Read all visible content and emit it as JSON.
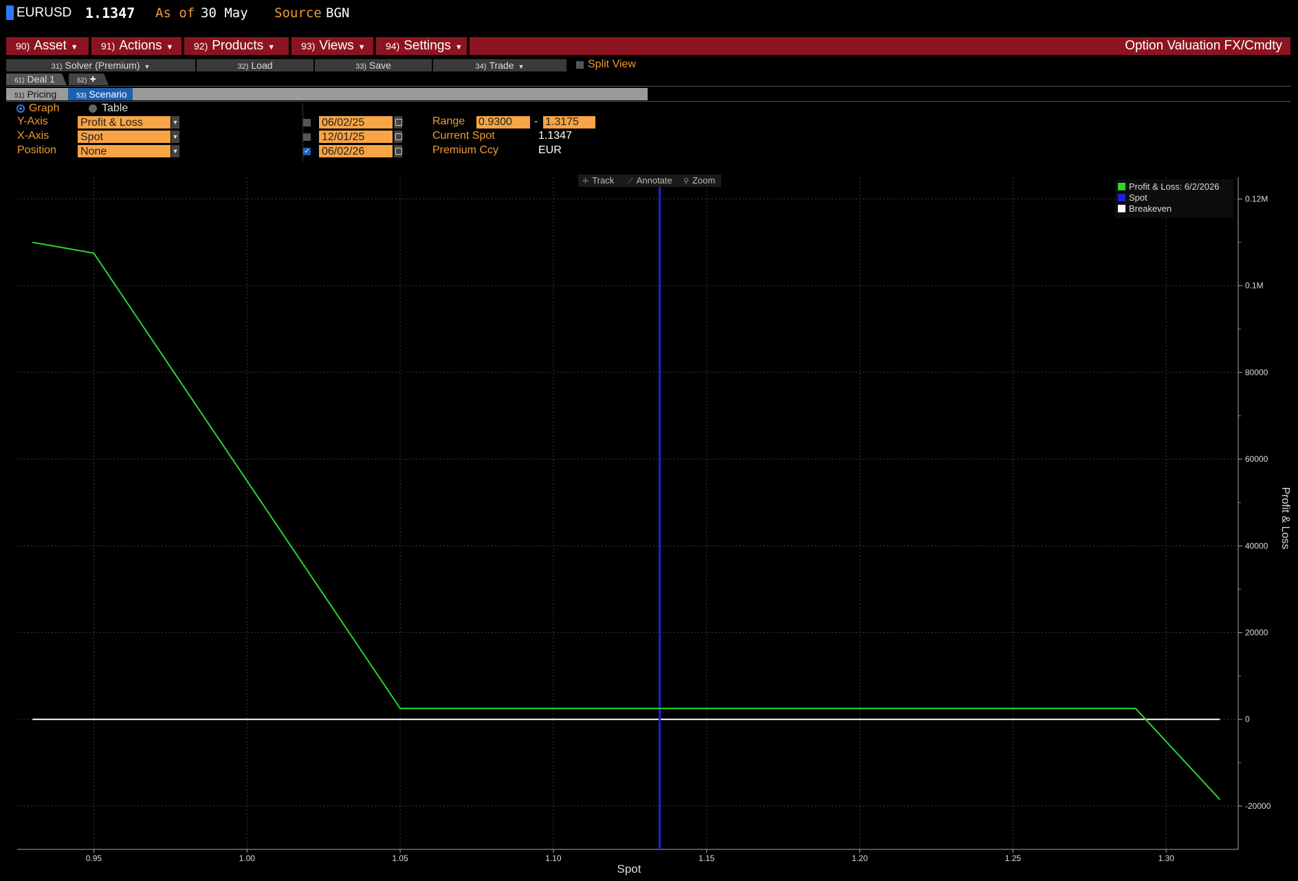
{
  "header": {
    "ticker": "EURUSD",
    "price": "1.1347",
    "as_of_label": "As of",
    "as_of_value": "30 May",
    "source_label": "Source",
    "source_value": "BGN"
  },
  "menu": {
    "items": [
      {
        "num": "90)",
        "label": "Asset"
      },
      {
        "num": "91)",
        "label": "Actions"
      },
      {
        "num": "92)",
        "label": "Products"
      },
      {
        "num": "93)",
        "label": "Views"
      },
      {
        "num": "94)",
        "label": "Settings"
      }
    ],
    "title": "Option Valuation FX/Cmdty"
  },
  "toolbar": {
    "solver": {
      "num": "31)",
      "label": "Solver (Premium)"
    },
    "load": {
      "num": "32)",
      "label": "Load"
    },
    "save": {
      "num": "33)",
      "label": "Save"
    },
    "trade": {
      "num": "34)",
      "label": "Trade"
    },
    "split_view": "Split View"
  },
  "deal_tabs": [
    {
      "num": "61)",
      "label": "Deal 1"
    },
    {
      "num": "62)",
      "label": "+"
    }
  ],
  "sub_tabs": [
    {
      "num": "51)",
      "label": "Pricing"
    },
    {
      "num": "53)",
      "label": "Scenario"
    }
  ],
  "controls": {
    "graph_label": "Graph",
    "table_label": "Table",
    "y_axis_label": "Y-Axis",
    "y_axis_value": "Profit & Loss",
    "x_axis_label": "X-Axis",
    "x_axis_value": "Spot",
    "position_label": "Position",
    "position_value": "None",
    "dates": [
      "06/02/25",
      "12/01/25",
      "06/02/26"
    ],
    "range_label": "Range",
    "range_low": "0.9300",
    "range_high": "1.3175",
    "current_spot_label": "Current Spot",
    "current_spot_value": "1.1347",
    "premium_ccy_label": "Premium Ccy",
    "premium_ccy_value": "EUR"
  },
  "chart_toolbar": {
    "track": "Track",
    "annotate": "Annotate",
    "zoom": "Zoom"
  },
  "chart_data": {
    "type": "line",
    "xlabel": "Spot",
    "ylabel": "Profit & Loss",
    "xlim": [
      0.925,
      1.3235
    ],
    "ylim": [
      -30000,
      125000.0
    ],
    "x_ticks": [
      0.95,
      1.0,
      1.05,
      1.1,
      1.15,
      1.2,
      1.25,
      1.3
    ],
    "x_tick_labels": [
      "0.95",
      "1.00",
      "1.05",
      "1.10",
      "1.15",
      "1.20",
      "1.25",
      "1.30"
    ],
    "y_ticks": [
      -20000,
      0,
      20000,
      40000,
      60000,
      80000,
      100000,
      120000
    ],
    "y_tick_labels": [
      "-20000",
      "0",
      "20000",
      "40000",
      "60000",
      "80000",
      "0.1M",
      "0.12M"
    ],
    "grid": true,
    "legend_position": "top-right",
    "series": [
      {
        "name": "Profit & Loss: 6/2/2026",
        "color": "#2bd62b",
        "points": [
          [
            0.93,
            110000
          ],
          [
            0.95,
            107500
          ],
          [
            1.05,
            2500
          ],
          [
            1.29,
            2500
          ],
          [
            1.3175,
            -18500
          ]
        ]
      },
      {
        "name": "Spot",
        "color": "#1f1fe0",
        "vertical_x": 1.1347
      },
      {
        "name": "Breakeven",
        "color": "#ffffff",
        "horizontal_y": 0,
        "x_range": [
          0.93,
          1.3175
        ]
      }
    ]
  }
}
